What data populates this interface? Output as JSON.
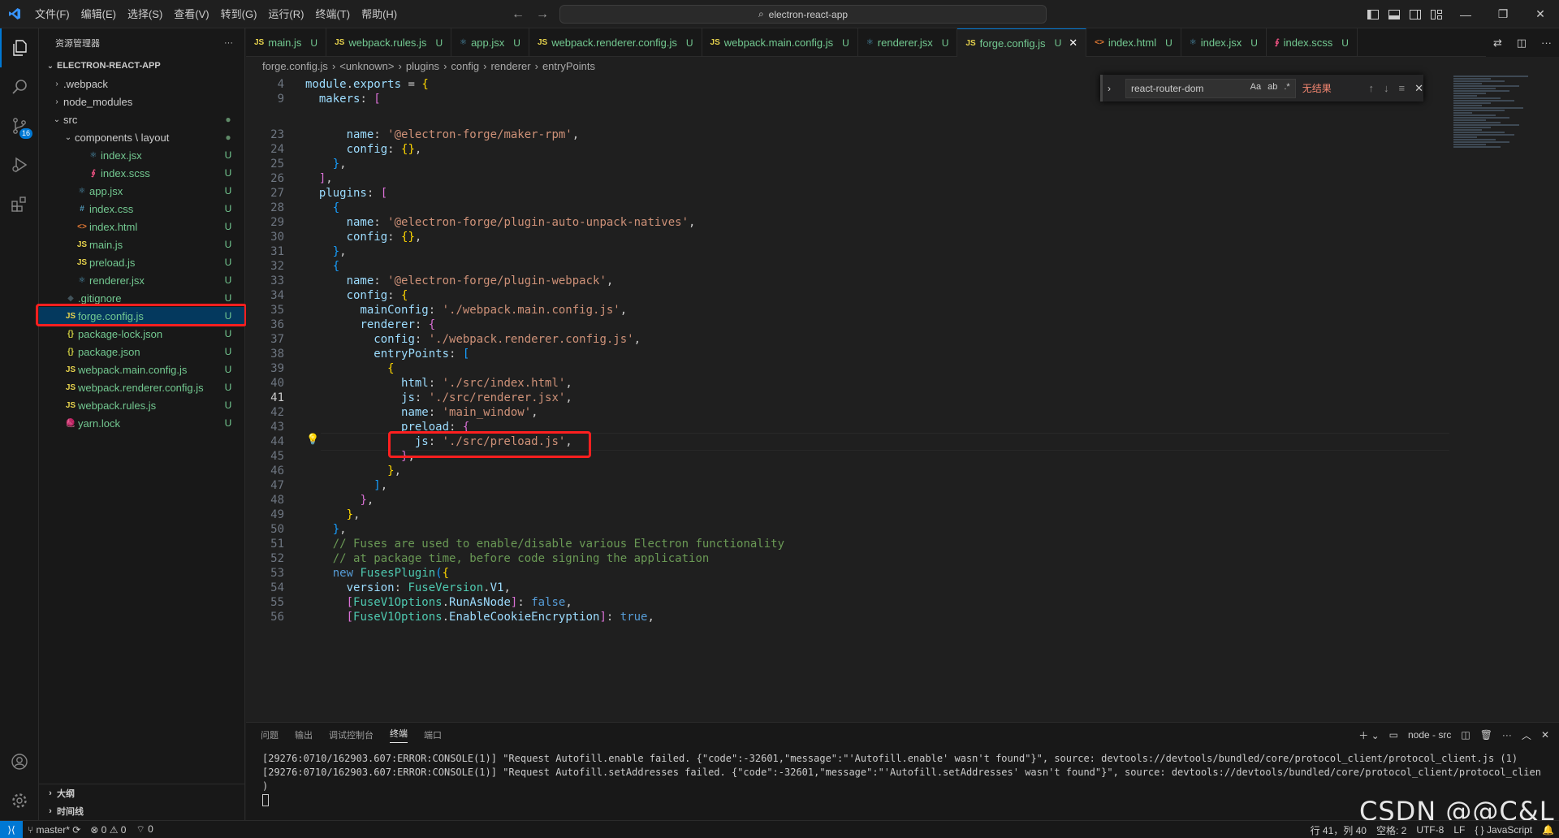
{
  "titlebar": {
    "menu": [
      "文件(F)",
      "编辑(E)",
      "选择(S)",
      "查看(V)",
      "转到(G)",
      "运行(R)",
      "终端(T)",
      "帮助(H)"
    ],
    "search": "electron-react-app"
  },
  "activitybar": {
    "scm_badge": "16"
  },
  "sidebar": {
    "title": "资源管理器",
    "project": "ELECTRON-REACT-APP",
    "items": [
      {
        "label": ".webpack",
        "chev": "›",
        "icon": "",
        "status": ""
      },
      {
        "label": "node_modules",
        "chev": "›",
        "icon": "",
        "status": ""
      },
      {
        "label": "src",
        "chev": "⌄",
        "icon": "",
        "status": "●"
      },
      {
        "label": "components \\ layout",
        "chev": "⌄",
        "icon": "",
        "status": "●"
      },
      {
        "label": "index.jsx",
        "chev": "",
        "icon": "⚛",
        "status": "U"
      },
      {
        "label": "index.scss",
        "chev": "",
        "icon": "∮",
        "status": "U"
      },
      {
        "label": "app.jsx",
        "chev": "",
        "icon": "⚛",
        "status": "U"
      },
      {
        "label": "index.css",
        "chev": "",
        "icon": "#",
        "status": "U"
      },
      {
        "label": "index.html",
        "chev": "",
        "icon": "<>",
        "status": "U"
      },
      {
        "label": "main.js",
        "chev": "",
        "icon": "JS",
        "status": "U"
      },
      {
        "label": "preload.js",
        "chev": "",
        "icon": "JS",
        "status": "U"
      },
      {
        "label": "renderer.jsx",
        "chev": "",
        "icon": "⚛",
        "status": "U"
      },
      {
        "label": ".gitignore",
        "chev": "",
        "icon": "◆",
        "status": "U"
      },
      {
        "label": "forge.config.js",
        "chev": "",
        "icon": "JS",
        "status": "U"
      },
      {
        "label": "package-lock.json",
        "chev": "",
        "icon": "{}",
        "status": "U"
      },
      {
        "label": "package.json",
        "chev": "",
        "icon": "{}",
        "status": "U"
      },
      {
        "label": "webpack.main.config.js",
        "chev": "",
        "icon": "JS",
        "status": "U"
      },
      {
        "label": "webpack.renderer.config.js",
        "chev": "",
        "icon": "JS",
        "status": "U"
      },
      {
        "label": "webpack.rules.js",
        "chev": "",
        "icon": "JS",
        "status": "U"
      },
      {
        "label": "yarn.lock",
        "chev": "",
        "icon": "🧶",
        "status": "U"
      }
    ],
    "outline": "大纲",
    "timeline": "时间线"
  },
  "tabs": [
    {
      "icon": "JS",
      "label": "main.js",
      "status": "U"
    },
    {
      "icon": "JS",
      "label": "webpack.rules.js",
      "status": "U"
    },
    {
      "icon": "⚛",
      "label": "app.jsx",
      "status": "U"
    },
    {
      "icon": "JS",
      "label": "webpack.renderer.config.js",
      "status": "U"
    },
    {
      "icon": "JS",
      "label": "webpack.main.config.js",
      "status": "U"
    },
    {
      "icon": "⚛",
      "label": "renderer.jsx",
      "status": "U"
    },
    {
      "icon": "JS",
      "label": "forge.config.js",
      "status": "U"
    },
    {
      "icon": "<>",
      "label": "index.html",
      "status": "U"
    },
    {
      "icon": "⚛",
      "label": "index.jsx",
      "status": "U"
    },
    {
      "icon": "∮",
      "label": "index.scss",
      "status": "U"
    }
  ],
  "breadcrumb": [
    "forge.config.js",
    "<unknown>",
    "plugins",
    "config",
    "renderer",
    "entryPoints"
  ],
  "find": {
    "query": "react-router-dom",
    "result": "无结果",
    "opts": [
      "Aa",
      "ab",
      ".*"
    ]
  },
  "code": [
    {
      "n": "4",
      "html": "<span class='k'>module</span><span class='p'>.</span><span class='k'>exports</span><span class='p'> = </span><span class='b1'>{</span>"
    },
    {
      "n": "9",
      "html": "  <span class='k'>makers</span><span class='p'>: </span><span class='b2'>[</span>"
    },
    {
      "n": "23",
      "html": "      <span class='k'>name</span><span class='p'>: </span><span class='s'>'@electron-forge/maker-rpm'</span><span class='p'>,</span>"
    },
    {
      "n": "24",
      "html": "      <span class='k'>config</span><span class='p'>: </span><span class='b1'>{}</span><span class='p'>,</span>"
    },
    {
      "n": "25",
      "html": "    <span class='b3'>}</span><span class='p'>,</span>"
    },
    {
      "n": "26",
      "html": "  <span class='b2'>]</span><span class='p'>,</span>"
    },
    {
      "n": "27",
      "html": "  <span class='k'>plugins</span><span class='p'>: </span><span class='b2'>[</span>"
    },
    {
      "n": "28",
      "html": "    <span class='b3'>{</span>"
    },
    {
      "n": "29",
      "html": "      <span class='k'>name</span><span class='p'>: </span><span class='s'>'@electron-forge/plugin-auto-unpack-natives'</span><span class='p'>,</span>"
    },
    {
      "n": "30",
      "html": "      <span class='k'>config</span><span class='p'>: </span><span class='b1'>{}</span><span class='p'>,</span>"
    },
    {
      "n": "31",
      "html": "    <span class='b3'>}</span><span class='p'>,</span>"
    },
    {
      "n": "32",
      "html": "    <span class='b3'>{</span>"
    },
    {
      "n": "33",
      "html": "      <span class='k'>name</span><span class='p'>: </span><span class='s'>'@electron-forge/plugin-webpack'</span><span class='p'>,</span>"
    },
    {
      "n": "34",
      "html": "      <span class='k'>config</span><span class='p'>: </span><span class='b1'>{</span>"
    },
    {
      "n": "35",
      "html": "        <span class='k'>mainConfig</span><span class='p'>: </span><span class='s'>'./webpack.main.config.js'</span><span class='p'>,</span>"
    },
    {
      "n": "36",
      "html": "        <span class='k'>renderer</span><span class='p'>: </span><span class='b2'>{</span>"
    },
    {
      "n": "37",
      "html": "          <span class='k'>config</span><span class='p'>: </span><span class='s'>'./webpack.renderer.config.js'</span><span class='p'>,</span>"
    },
    {
      "n": "38",
      "html": "          <span class='k'>entryPoints</span><span class='p'>: </span><span class='b3'>[</span>"
    },
    {
      "n": "39",
      "html": "            <span class='b1'>{</span>"
    },
    {
      "n": "40",
      "html": "              <span class='k'>html</span><span class='p'>: </span><span class='s'>'./src/index.html'</span><span class='p'>,</span>"
    },
    {
      "n": "41",
      "html": "              <span class='k'>js</span><span class='p'>: </span><span class='s'>'./src/renderer.jsx'</span><span class='p'>,</span>"
    },
    {
      "n": "42",
      "html": "              <span class='k'>name</span><span class='p'>: </span><span class='s'>'main_window'</span><span class='p'>,</span>"
    },
    {
      "n": "43",
      "html": "              <span class='k'>preload</span><span class='p'>: </span><span class='b2'>{</span>"
    },
    {
      "n": "44",
      "html": "                <span class='k'>js</span><span class='p'>: </span><span class='s'>'./src/preload.js'</span><span class='p'>,</span>"
    },
    {
      "n": "45",
      "html": "              <span class='b2'>}</span><span class='p'>,</span>"
    },
    {
      "n": "46",
      "html": "            <span class='b1'>}</span><span class='p'>,</span>"
    },
    {
      "n": "47",
      "html": "          <span class='b3'>]</span><span class='p'>,</span>"
    },
    {
      "n": "48",
      "html": "        <span class='b2'>}</span><span class='p'>,</span>"
    },
    {
      "n": "49",
      "html": "      <span class='b1'>}</span><span class='p'>,</span>"
    },
    {
      "n": "50",
      "html": "    <span class='b3'>}</span><span class='p'>,</span>"
    },
    {
      "n": "51",
      "html": "    <span class='cm'>// Fuses are used to enable/disable various Electron functionality</span>"
    },
    {
      "n": "52",
      "html": "    <span class='cm'>// at package time, before code signing the application</span>"
    },
    {
      "n": "53",
      "html": "    <span class='kw'>new</span> <span class='cls'>FusesPlugin</span><span class='b3'>(</span><span class='b1'>{</span>"
    },
    {
      "n": "54",
      "html": "      <span class='k'>version</span><span class='p'>: </span><span class='cls'>FuseVersion</span><span class='p'>.</span><span class='k'>V1</span><span class='p'>,</span>"
    },
    {
      "n": "55",
      "html": "      <span class='b2'>[</span><span class='cls'>FuseV1Options</span><span class='p'>.</span><span class='k'>RunAsNode</span><span class='b2'>]</span><span class='p'>: </span><span class='kw'>false</span><span class='p'>,</span>"
    },
    {
      "n": "56",
      "html": "      <span class='b2'>[</span><span class='cls'>FuseV1Options</span><span class='p'>.</span><span class='k'>EnableCookieEncryption</span><span class='b2'>]</span><span class='p'>: </span><span class='kw'>true</span><span class='p'>,</span>"
    }
  ],
  "panel": {
    "tabs": [
      "问题",
      "输出",
      "调试控制台",
      "终端",
      "端口"
    ],
    "active": "终端",
    "terminal_name": "node - src",
    "lines": [
      "[29276:0710/162903.607:ERROR:CONSOLE(1)] \"Request Autofill.enable failed. {\"code\":-32601,\"message\":\"'Autofill.enable' wasn't found\"}\", source: devtools://devtools/bundled/core/protocol_client/protocol_client.js (1)",
      "[29276:0710/162903.607:ERROR:CONSOLE(1)] \"Request Autofill.setAddresses failed. {\"code\":-32601,\"message\":\"'Autofill.setAddresses' wasn't found\"}\", source: devtools://devtools/bundled/core/protocol_client/protocol_client.js (1",
      ")"
    ]
  },
  "watermark": "CSDN @@C&L",
  "statusbar": {
    "branch": "master*",
    "errors": "0",
    "warnings": "0",
    "ports": "0",
    "position": "行 41，列 40",
    "spaces": "空格: 2",
    "encoding": "UTF-8",
    "eol": "LF",
    "language": "JavaScript"
  }
}
